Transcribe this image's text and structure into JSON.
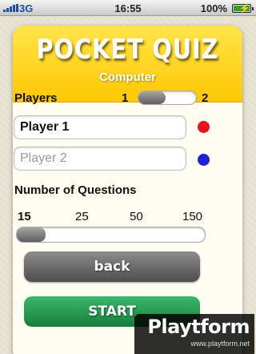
{
  "status_bar": {
    "carrier": "3G",
    "time": "16:55",
    "battery": "100%"
  },
  "header": {
    "title": "POCKET QUIZ",
    "subtitle": "Computer"
  },
  "players": {
    "label": "Players",
    "min": "1",
    "max": "2",
    "selected_fraction": 0.0,
    "player1_value": "Player 1",
    "player2_placeholder": "Player 2",
    "player1_color": "#e4141b",
    "player2_color": "#1a24d2"
  },
  "questions": {
    "label": "Number of Questions",
    "options": [
      "15",
      "25",
      "50",
      "150"
    ],
    "selected": "15",
    "selected_fraction": 0.0
  },
  "buttons": {
    "back": "back",
    "start": "START"
  },
  "watermark": {
    "brand": "Playtform",
    "url": "www.playtform.net"
  }
}
